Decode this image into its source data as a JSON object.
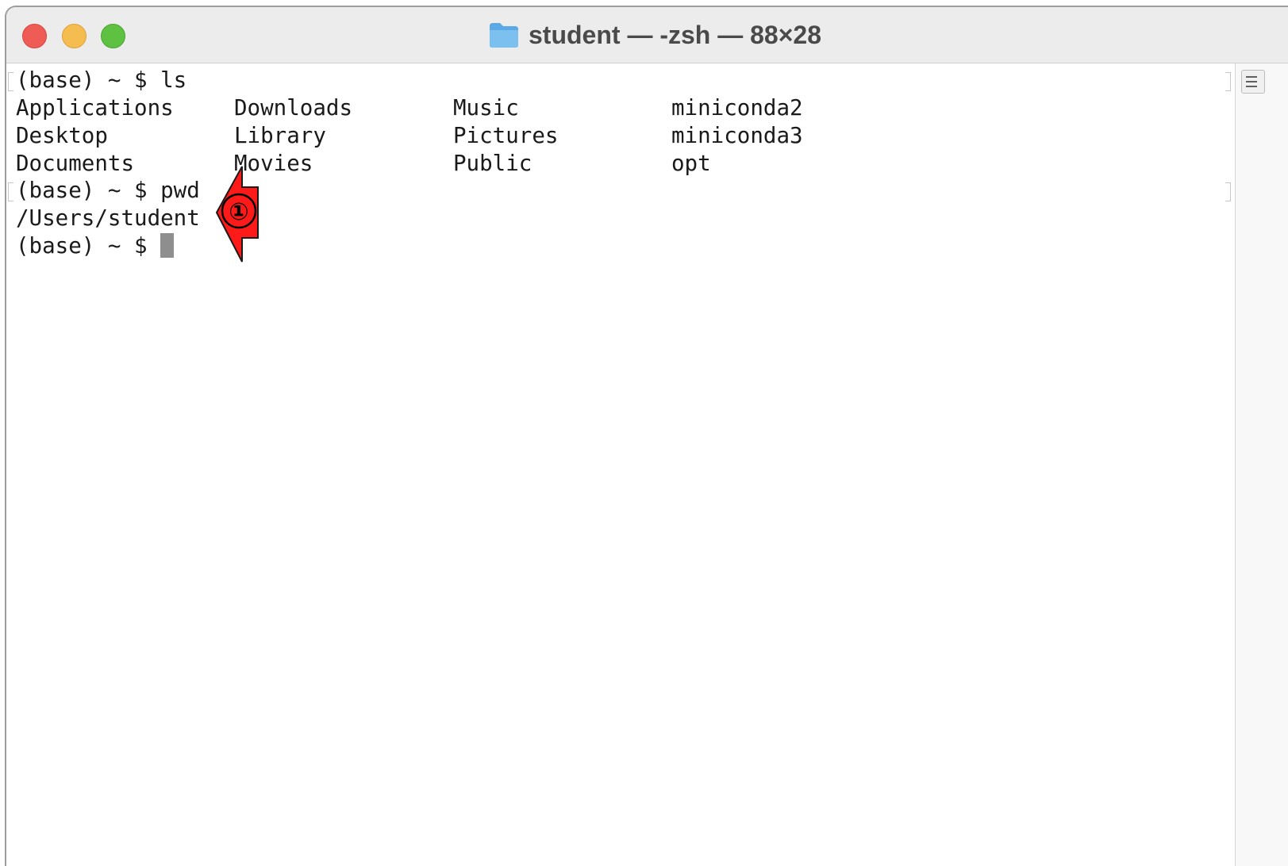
{
  "window": {
    "title": "student — -zsh — 88×28",
    "icon": "folder-icon"
  },
  "traffic_lights": {
    "close_color": "#ee5c55",
    "minimize_color": "#f5bd4f",
    "maximize_color": "#5ec142"
  },
  "terminal": {
    "cmd1": "(base) ~ $ ls",
    "ls_output": {
      "col1": [
        "Applications",
        "Desktop",
        "Documents"
      ],
      "col2": [
        "Downloads",
        "Library",
        "Movies"
      ],
      "col3": [
        "Music",
        "Pictures",
        "Public"
      ],
      "col4": [
        "miniconda2",
        "miniconda3",
        "opt"
      ]
    },
    "cmd2": "(base) ~ $ pwd",
    "pwd_output": "/Users/student",
    "prompt": "(base) ~ $ "
  },
  "annotation": {
    "marker": "①",
    "arrow_color": "#ff0000"
  }
}
